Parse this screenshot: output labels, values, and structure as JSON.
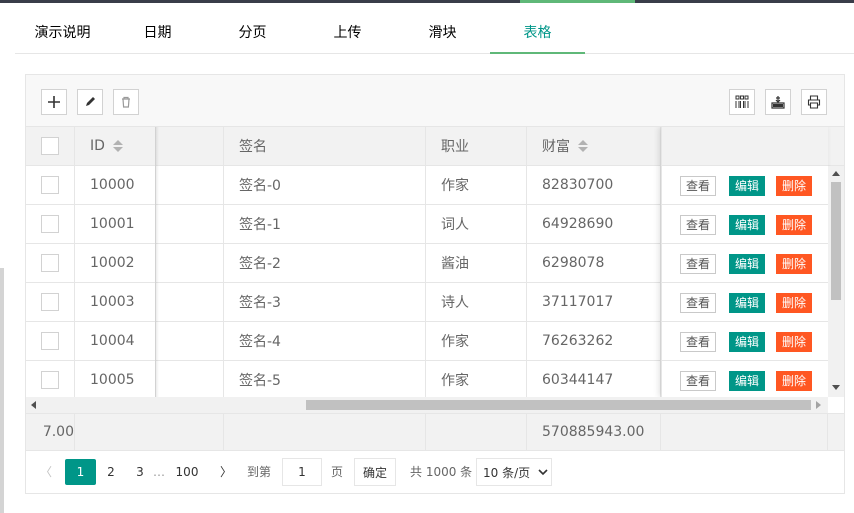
{
  "tabs": [
    "演示说明",
    "日期",
    "分页",
    "上传",
    "滑块",
    "表格"
  ],
  "active_tab": "表格",
  "toolbar": {
    "left": [
      "add-icon",
      "edit-icon",
      "delete-icon"
    ],
    "right": [
      "columns-icon",
      "export-icon",
      "print-icon"
    ]
  },
  "table": {
    "headers": {
      "id": "ID",
      "sign": "签名",
      "job": "职业",
      "wealth": "财富"
    },
    "rows": [
      {
        "id": "10000",
        "sign": "签名-0",
        "job": "作家",
        "wealth": "82830700"
      },
      {
        "id": "10001",
        "sign": "签名-1",
        "job": "词人",
        "wealth": "64928690"
      },
      {
        "id": "10002",
        "sign": "签名-2",
        "job": "酱油",
        "wealth": "6298078"
      },
      {
        "id": "10003",
        "sign": "签名-3",
        "job": "诗人",
        "wealth": "37117017"
      },
      {
        "id": "10004",
        "sign": "签名-4",
        "job": "作家",
        "wealth": "76263262"
      },
      {
        "id": "10005",
        "sign": "签名-5",
        "job": "作家",
        "wealth": "60344147"
      }
    ],
    "actions": {
      "view": "查看",
      "edit": "编辑",
      "delete": "删除"
    },
    "totals": {
      "left": "7.00",
      "wealth": "570885943.00"
    }
  },
  "pager": {
    "prev": "〈",
    "pages": [
      "1",
      "2",
      "3"
    ],
    "ellipsis": "…",
    "last": "100",
    "next": "〉",
    "goto_label": "到第",
    "goto_value": "1",
    "page_suffix": "页",
    "confirm": "确定",
    "total": "共 1000 条",
    "per_page": "10 条/页"
  },
  "colors": {
    "accent": "#009688",
    "tab_underline": "#5fb878",
    "danger": "#ff5722"
  }
}
